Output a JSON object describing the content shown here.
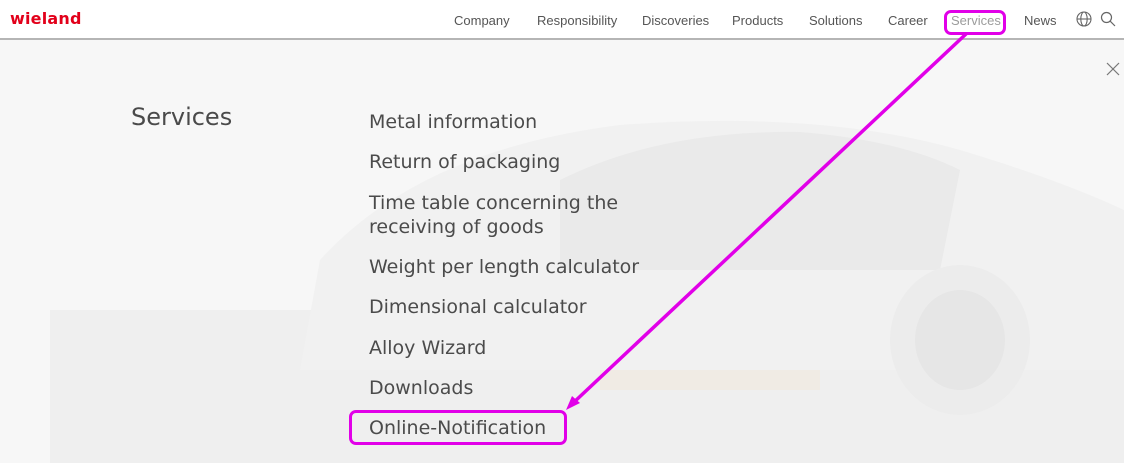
{
  "brand": {
    "logo_text": "wieland",
    "color": "#e2001a"
  },
  "nav": {
    "items": [
      {
        "label": "Company"
      },
      {
        "label": "Responsibility"
      },
      {
        "label": "Discoveries"
      },
      {
        "label": "Products"
      },
      {
        "label": "Solutions"
      },
      {
        "label": "Career"
      },
      {
        "label": "Services",
        "active": true
      },
      {
        "label": "News"
      }
    ],
    "icons": [
      "globe-icon",
      "search-icon"
    ]
  },
  "overlay": {
    "title": "Services",
    "menu": [
      {
        "label": "Metal information"
      },
      {
        "label": "Return of packaging"
      },
      {
        "label_line1": "Time table concerning the",
        "label_line2": "receiving of goods"
      },
      {
        "label": "Weight per length calculator"
      },
      {
        "label": "Dimensional calculator"
      },
      {
        "label": "Alloy Wizard"
      },
      {
        "label": "Downloads"
      },
      {
        "label": "Online-Notification"
      }
    ],
    "close_icon": "close-icon"
  },
  "annotation": {
    "color": "#e100e8"
  }
}
